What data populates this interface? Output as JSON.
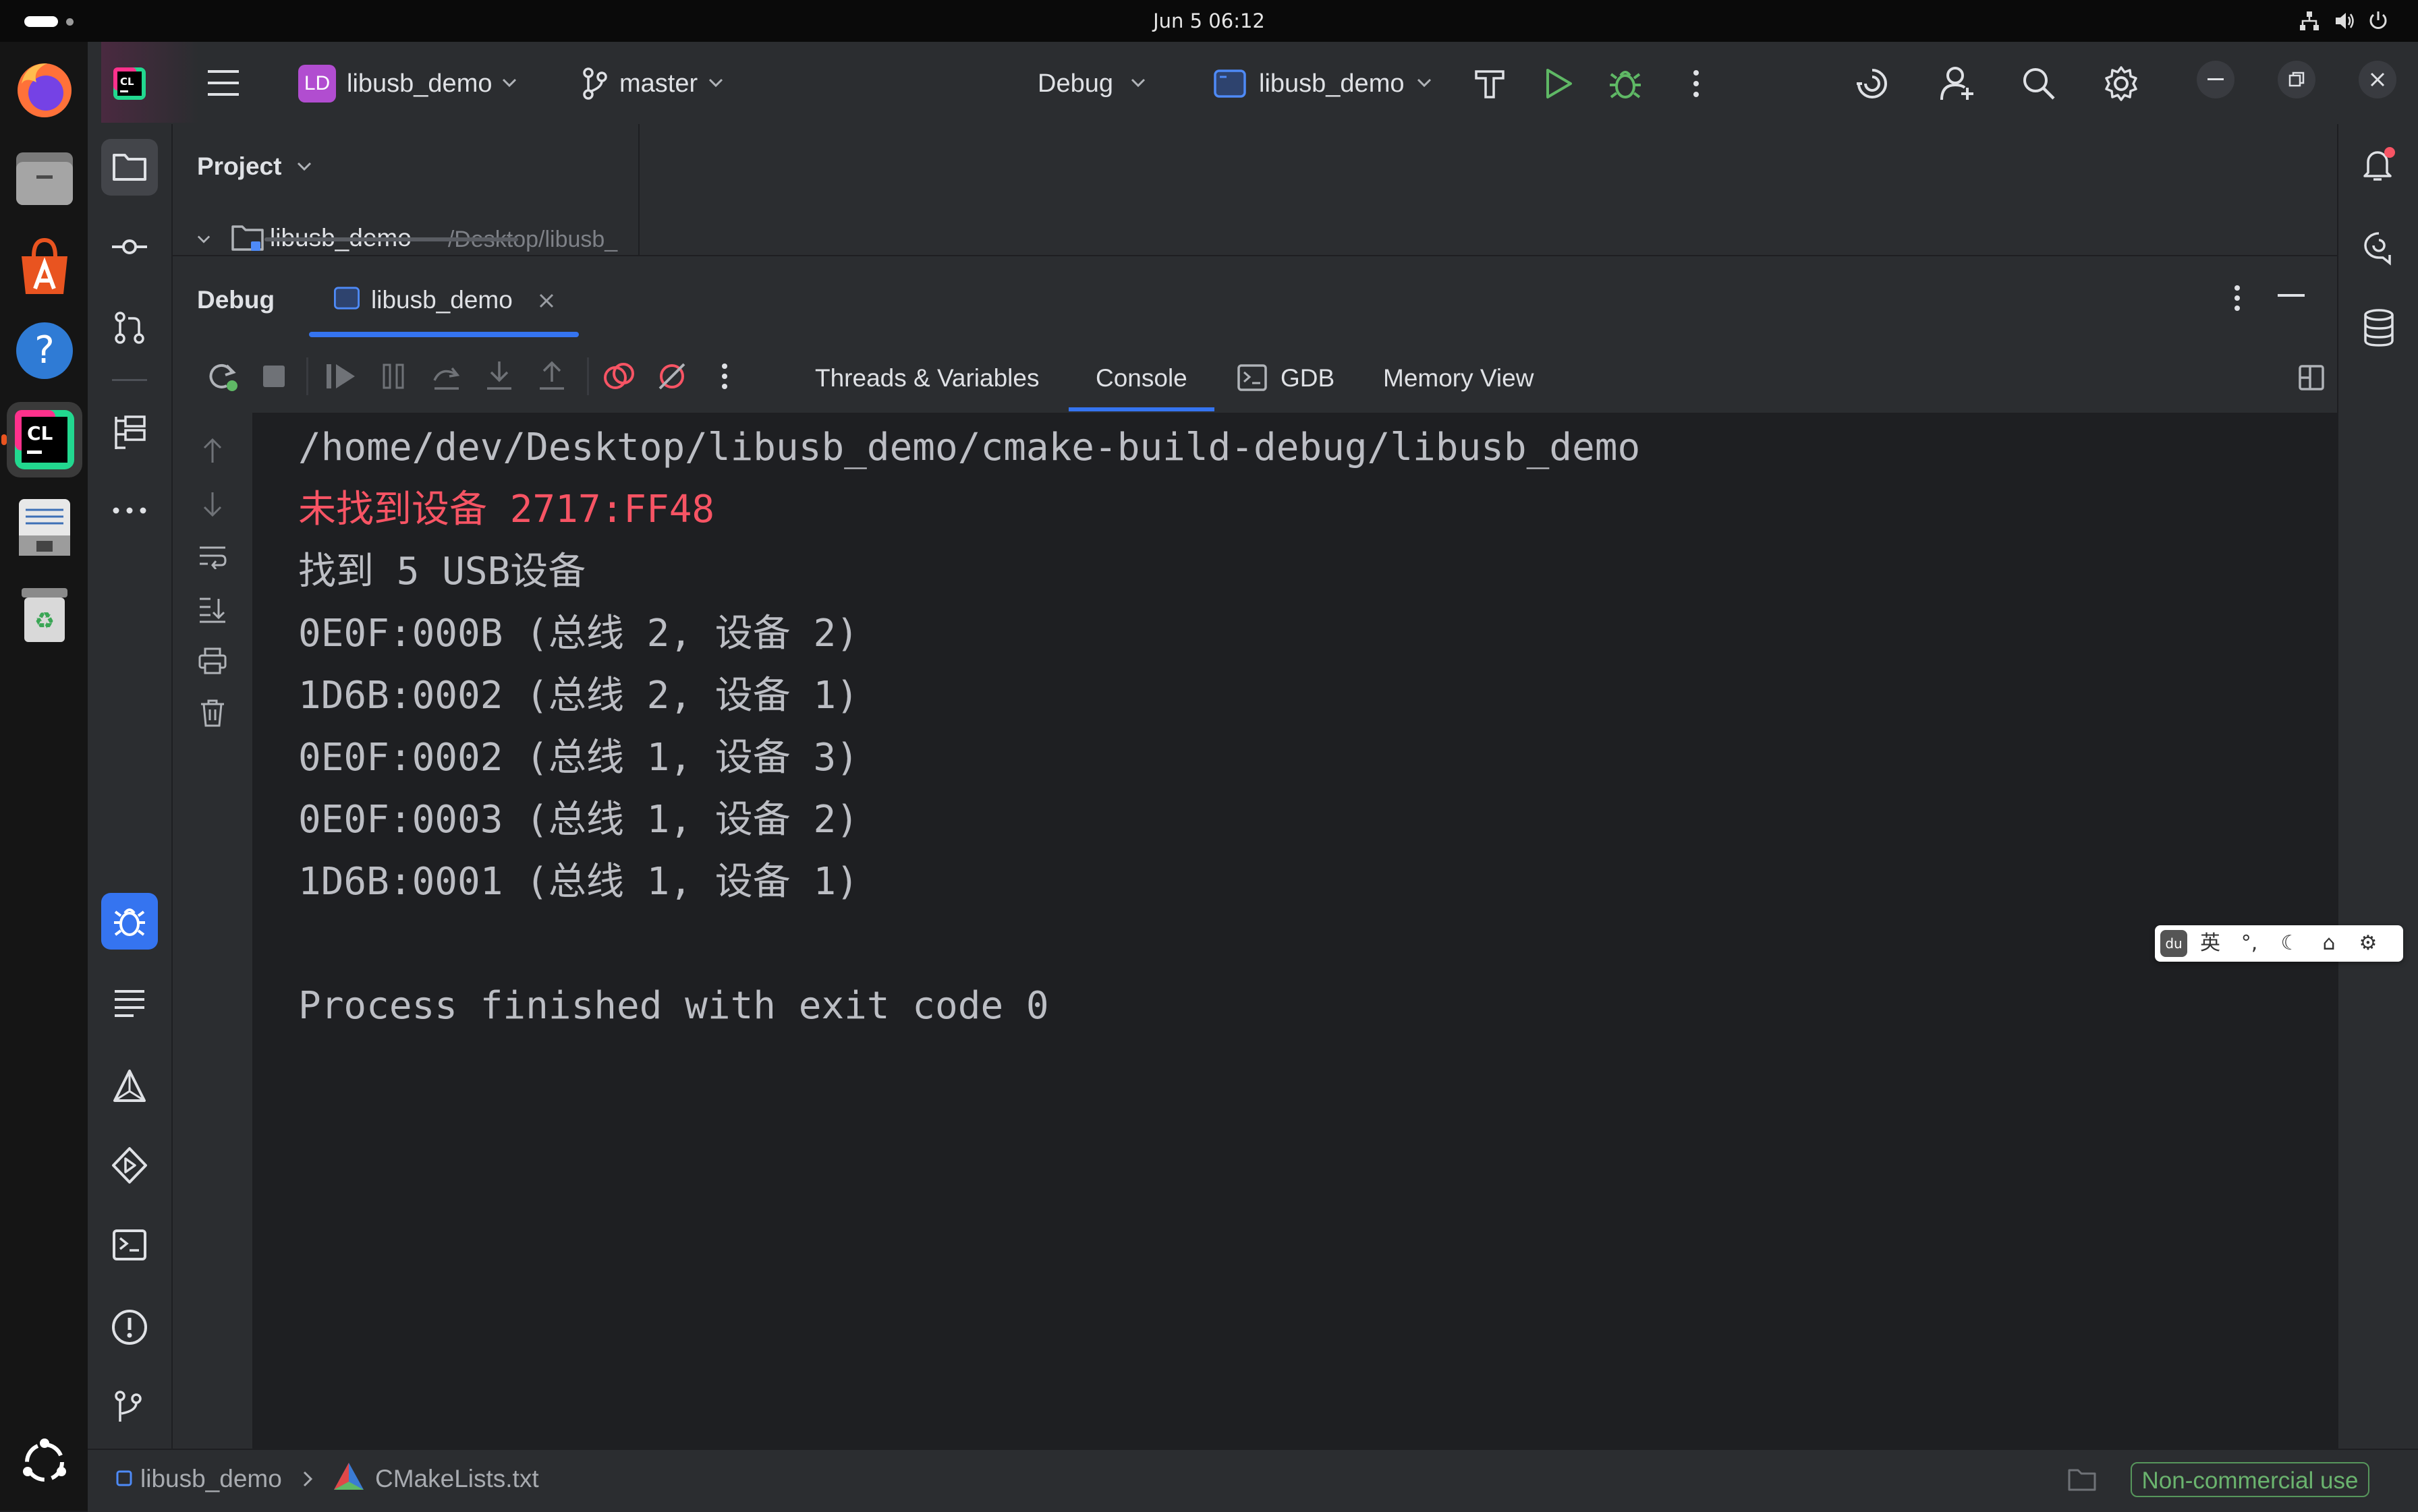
{
  "system": {
    "clock": "Jun 5  06:12"
  },
  "dock": {
    "items": [
      "Firefox",
      "Files",
      "App Center",
      "Help",
      "CLion",
      "Text Editor",
      "Trash",
      "Show Apps"
    ]
  },
  "toolbar": {
    "project_badge": "LD",
    "project_name": "libusb_demo",
    "vcs_branch": "master",
    "run_config_mode": "Debug",
    "run_target": "libusb_demo",
    "accent": "#4e8af7",
    "run_color": "#5fb865",
    "badge_color": "#b14dd0"
  },
  "project": {
    "title": "Project",
    "root_name": "libusb_demo",
    "root_path": "~/Desktop/libusb_"
  },
  "debug": {
    "title": "Debug",
    "session_tab": "libusb_demo",
    "tabs": [
      "Threads & Variables",
      "Console",
      "GDB",
      "Memory View"
    ],
    "active_tab": "Console"
  },
  "console": {
    "lines": [
      "/home/dev/Desktop/libusb_demo/cmake-build-debug/libusb_demo",
      "未找到设备 2717:FF48",
      "找到 5 USB设备",
      "0E0F:000B (总线 2, 设备 2)",
      "1D6B:0002 (总线 2, 设备 1)",
      "0E0F:0002 (总线 1, 设备 3)",
      "0E0F:0003 (总线 1, 设备 2)",
      "1D6B:0001 (总线 1, 设备 1)",
      "",
      "Process finished with exit code 0"
    ],
    "error_color": "#f75464"
  },
  "statusbar": {
    "breadcrumb_project": "libusb_demo",
    "breadcrumb_file": "CMakeLists.txt",
    "license": "Non-commercial use"
  },
  "ime": {
    "lang": "英",
    "punct": "°,"
  }
}
